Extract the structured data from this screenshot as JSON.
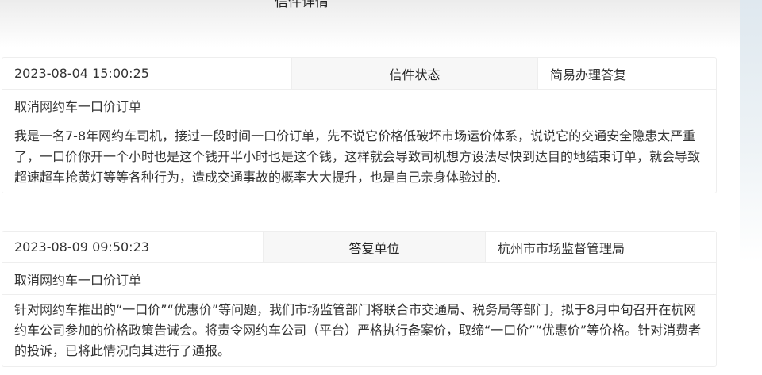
{
  "page_title": "信件详情",
  "letter": {
    "date": "2023-08-04 15:00:25",
    "status_label": "信件状态",
    "status_value": "简易办理答复",
    "subject": "取消网约车一口价订单",
    "content": "我是一名7-8年网约车司机，接过一段时间一口价订单，先不说它价格低破坏市场运价体系，说说它的交通安全隐患太严重了，一口价你开一个小时也是这个钱开半小时也是这个钱，这样就会导致司机想方设法尽快到达目的地结束订单，就会导致超速超车抢黄灯等等各种行为，造成交通事故的概率大大提升，也是自己亲身体验过的."
  },
  "reply": {
    "date": "2023-08-09 09:50:23",
    "unit_label": "答复单位",
    "unit_value": "杭州市市场监督管理局",
    "subject": "取消网约车一口价订单",
    "content": "针对网约车推出的“一口价”“优惠价”等问题，我们市场监管部门将联合市交通局、税务局等部门，拟于8月中旬召开在杭网约车公司参加的价格政策告诫会。将责令网约车公司（平台）严格执行备案价，取缔“一口价”“优惠价”等价格。针对消费者的投诉，已将此情况向其进行了通报。"
  }
}
